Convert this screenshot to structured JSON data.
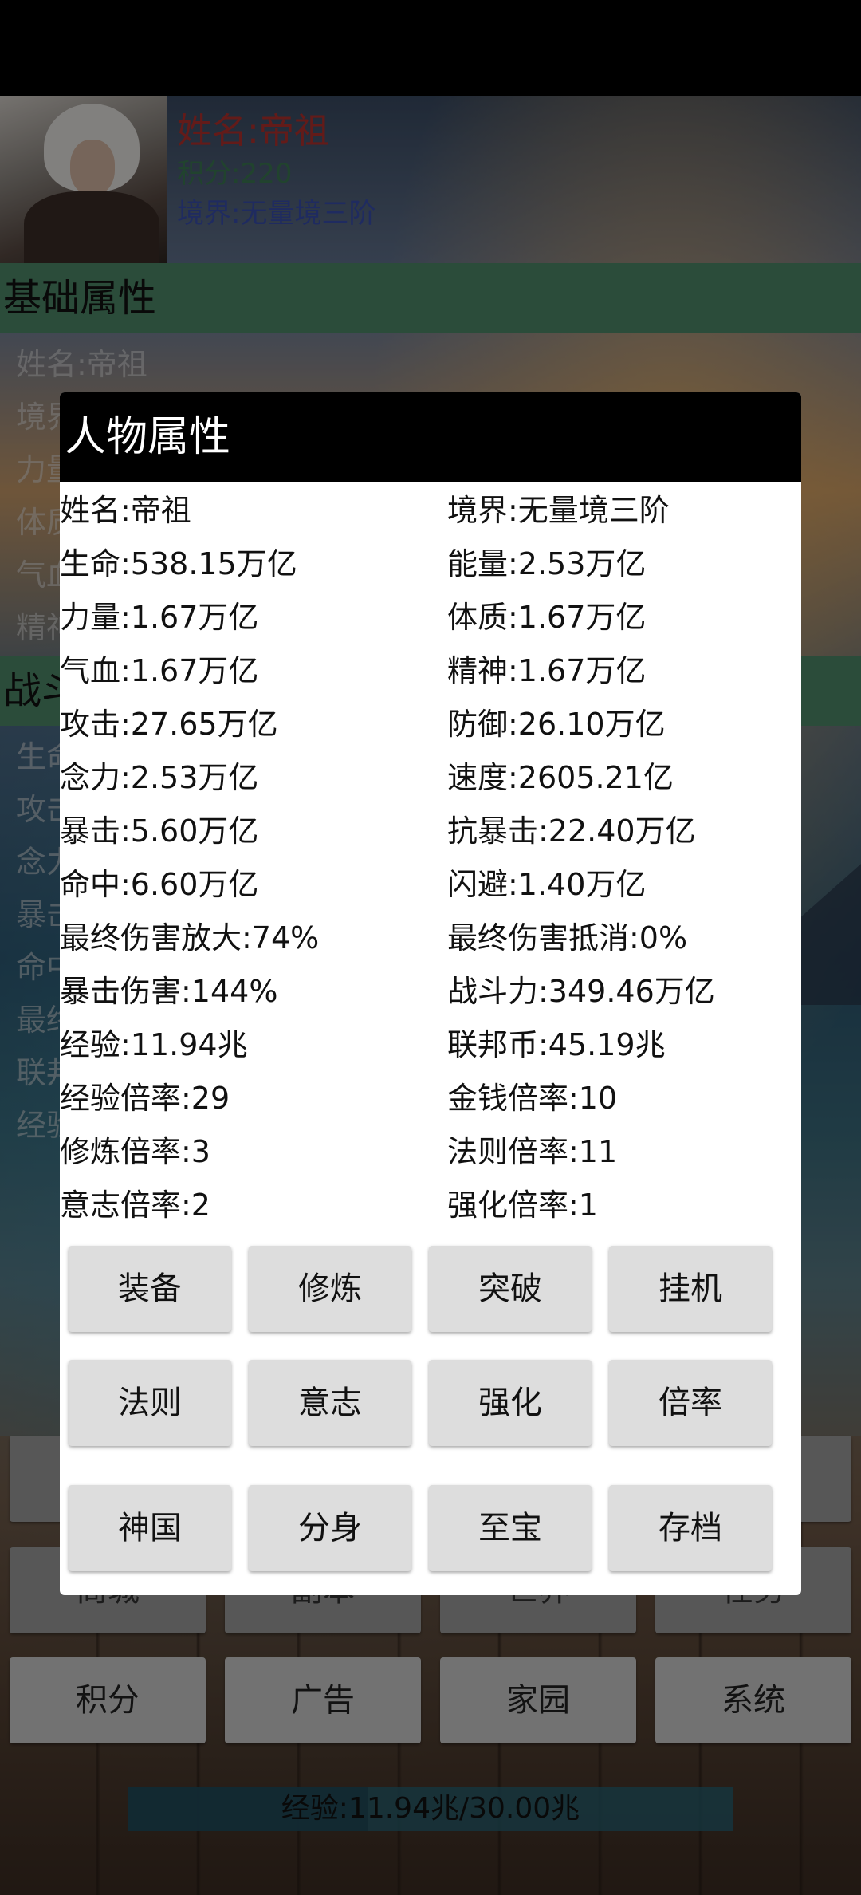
{
  "player": {
    "name": "姓名:帝祖",
    "score": "积分:220",
    "realm": "境界:无量境三阶"
  },
  "sections": {
    "basic": "基础属性",
    "combat_partial": "战斗"
  },
  "background_basic": [
    "姓名:帝祖",
    "境界",
    "力量",
    "体质",
    "气血",
    "精神"
  ],
  "background_combat": [
    "生命",
    "攻击",
    "念力",
    "暴击",
    "命中",
    "最终",
    "联邦",
    "经验"
  ],
  "background_buttons": [
    "商城",
    "副本",
    "世界",
    "任务",
    "积分",
    "广告",
    "家园",
    "系统"
  ],
  "exp_bar": {
    "text": "经验:11.94兆/30.00兆",
    "current": 11.94,
    "max": 30.0
  },
  "dialog": {
    "title": "人物属性",
    "stats_left": [
      "姓名:帝祖",
      "生命:538.15万亿",
      "力量:1.67万亿",
      "气血:1.67万亿",
      "攻击:27.65万亿",
      "念力:2.53万亿",
      "暴击:5.60万亿",
      "命中:6.60万亿",
      "最终伤害放大:74%",
      "暴击伤害:144%",
      "经验:11.94兆",
      "经验倍率:29",
      "修炼倍率:3",
      "意志倍率:2"
    ],
    "stats_right": [
      "境界:无量境三阶",
      "能量:2.53万亿",
      "体质:1.67万亿",
      "精神:1.67万亿",
      "防御:26.10万亿",
      "速度:2605.21亿",
      "抗暴击:22.40万亿",
      "闪避:1.40万亿",
      "最终伤害抵消:0%",
      "战斗力:349.46万亿",
      "联邦币:45.19兆",
      "金钱倍率:10",
      "法则倍率:11",
      "强化倍率:1"
    ],
    "buttons": [
      "装备",
      "修炼",
      "突破",
      "挂机",
      "法则",
      "意志",
      "强化",
      "倍率",
      "神国",
      "分身",
      "至宝",
      "存档"
    ]
  }
}
